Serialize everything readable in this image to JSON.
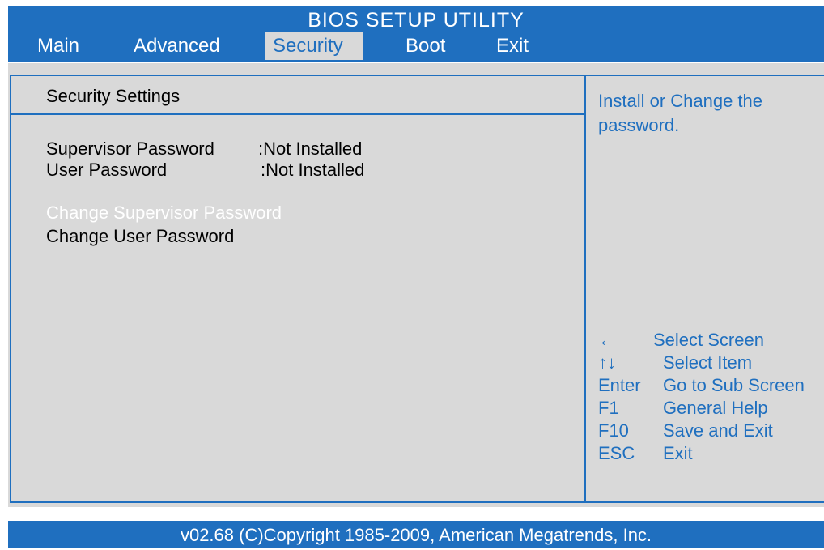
{
  "header": {
    "title": "BIOS SETUP UTILITY",
    "tabs": [
      {
        "label": "Main"
      },
      {
        "label": "Advanced"
      },
      {
        "label": "Security",
        "active": true
      },
      {
        "label": "Boot"
      },
      {
        "label": "Exit"
      }
    ]
  },
  "main": {
    "section_title": "Security Settings",
    "supervisor_password": {
      "label": "Supervisor Password",
      "value": ":Not Installed"
    },
    "user_password": {
      "label": "User Password",
      "value": ":Not Installed"
    },
    "menu_items": [
      {
        "label": "Change Supervisor Password",
        "selected": true
      },
      {
        "label": "Change User Password"
      }
    ]
  },
  "help": {
    "text": "Install or Change the password.",
    "keys": [
      {
        "key": "←",
        "desc": "Select Screen"
      },
      {
        "key": "↑↓",
        "desc": "Select Item"
      },
      {
        "key": "Enter",
        "desc": "Go to Sub Screen"
      },
      {
        "key": "F1",
        "desc": "General Help"
      },
      {
        "key": "F10",
        "desc": "Save and Exit"
      },
      {
        "key": "ESC",
        "desc": "Exit"
      }
    ]
  },
  "footer": {
    "text": "v02.68 (C)Copyright 1985-2009, American Megatrends, Inc."
  },
  "colors": {
    "accent": "#1f6fbf",
    "panel": "#d9d9d9",
    "highlight_text": "#ffffff"
  }
}
